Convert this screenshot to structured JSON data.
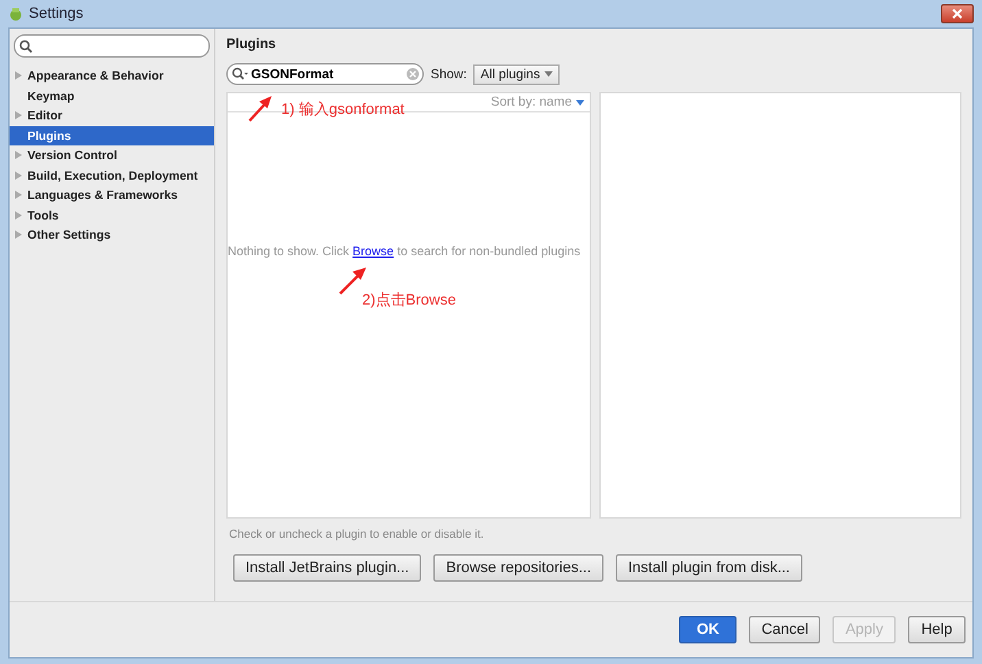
{
  "window": {
    "title": "Settings"
  },
  "sidebar": {
    "items": [
      {
        "label": "Appearance & Behavior",
        "expandable": true,
        "selected": false
      },
      {
        "label": "Keymap",
        "expandable": false,
        "selected": false
      },
      {
        "label": "Editor",
        "expandable": true,
        "selected": false
      },
      {
        "label": "Plugins",
        "expandable": false,
        "selected": true
      },
      {
        "label": "Version Control",
        "expandable": true,
        "selected": false
      },
      {
        "label": "Build, Execution, Deployment",
        "expandable": true,
        "selected": false
      },
      {
        "label": "Languages & Frameworks",
        "expandable": true,
        "selected": false
      },
      {
        "label": "Tools",
        "expandable": true,
        "selected": false
      },
      {
        "label": "Other Settings",
        "expandable": true,
        "selected": false
      }
    ]
  },
  "plugins": {
    "title": "Plugins",
    "search": {
      "value": "GSONFormat"
    },
    "show_label": "Show:",
    "show_value": "All plugins",
    "sort_label": "Sort by: name",
    "empty_message": {
      "before": "Nothing to show. Click ",
      "link": "Browse",
      "after": " to search for non-bundled plugins"
    },
    "hint": "Check or uncheck a plugin to enable or disable it.",
    "buttons": [
      "Install JetBrains plugin...",
      "Browse repositories...",
      "Install plugin from disk..."
    ]
  },
  "annotations": [
    {
      "text": "1) 输入gsonformat"
    },
    {
      "text": "2)点击Browse"
    }
  ],
  "footer_buttons": [
    {
      "label": "OK",
      "kind": "primary",
      "disabled": false
    },
    {
      "label": "Cancel",
      "kind": "normal",
      "disabled": false
    },
    {
      "label": "Apply",
      "kind": "normal",
      "disabled": true
    },
    {
      "label": "Help",
      "kind": "normal",
      "disabled": false
    }
  ]
}
